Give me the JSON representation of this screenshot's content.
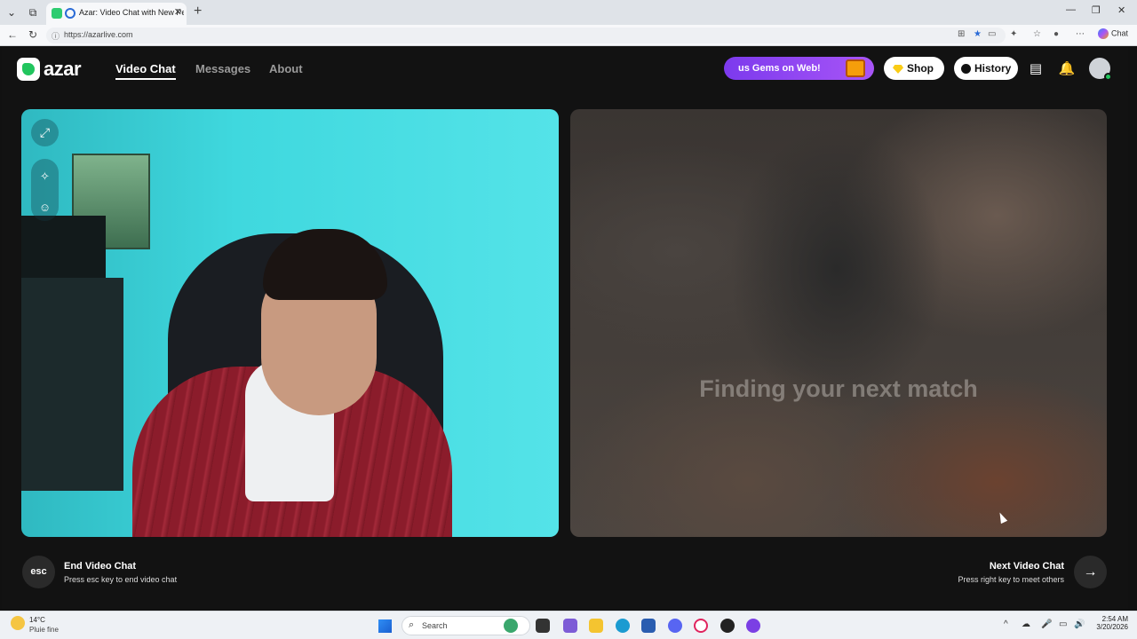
{
  "browser": {
    "tab_title": "Azar: Video Chat with New Pe",
    "tab_close": "✕",
    "new_tab": "+",
    "url": "https://azarlive.com",
    "copilot_label": "Chat"
  },
  "header": {
    "logo_text": "azar",
    "nav": [
      "Video Chat",
      "Messages",
      "About"
    ],
    "promo": "us Gems on Web!",
    "shop": "Shop",
    "history": "History"
  },
  "stage": {
    "finding_text": "Finding your next match"
  },
  "controls": {
    "esc_label": "esc",
    "end_title": "End Video Chat",
    "end_sub": "Press esc key to end video chat",
    "next_title": "Next Video Chat",
    "next_sub": "Press right key to meet others",
    "next_arrow": "→"
  },
  "taskbar": {
    "temp": "14°C",
    "weather": "Pluie fine",
    "search": "Search",
    "time": "2:54 AM",
    "date": "3/20/2026"
  },
  "colors": {
    "accent_green": "#22c55e",
    "promo_purple": "#8b3dea",
    "bg_dark": "#121212"
  }
}
